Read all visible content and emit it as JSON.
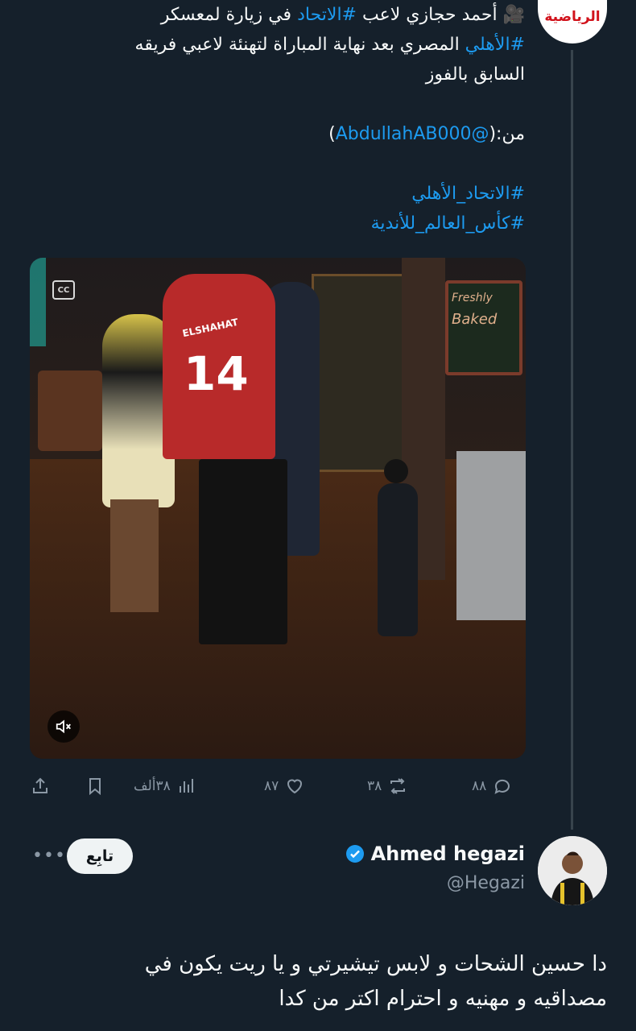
{
  "source": {
    "avatar_text": "الرياضية"
  },
  "tweet": {
    "line1_emoji": "🎥",
    "line1_a": "أحمد حجازي لاعب ",
    "line1_tag1": "#الاتحاد",
    "line1_b": " في زيارة لمعسكر",
    "line2_tag": "#الأهلي",
    "line2_b": " المصري بعد نهاية المباراة لتهنئة لاعبي فريقه",
    "line3": "السابق بالفوز",
    "from_label": "من:(",
    "from_mention": "@AbdullahAB000",
    "from_close": ")",
    "hashtag_1": "#الاتحاد_الأهلي",
    "hashtag_2": "#كأس_العالم_للأندية"
  },
  "media": {
    "jersey_name": "ELSHAHAT",
    "jersey_number": "14",
    "sign_text_1": "Freshly",
    "sign_text_2": "Baked"
  },
  "actions": {
    "replies": "٨٨",
    "retweets": "٣٨",
    "likes": "٨٧",
    "views": "٣٨ألف"
  },
  "reply": {
    "name": "Ahmed hegazi",
    "handle": "@Hegazi",
    "follow_label": "تابِع",
    "more_label": "•••",
    "text_line1": "دا حسين الشحات و لابس تيشيرتي و يا ريت يكون في",
    "text_line2": "مصداقيه و مهنيه و احترام اكتر من كدا"
  },
  "colors": {
    "background": "#15202b",
    "link": "#1d9bf0",
    "muted": "#8b98a5",
    "verified": "#1d9bf0"
  }
}
